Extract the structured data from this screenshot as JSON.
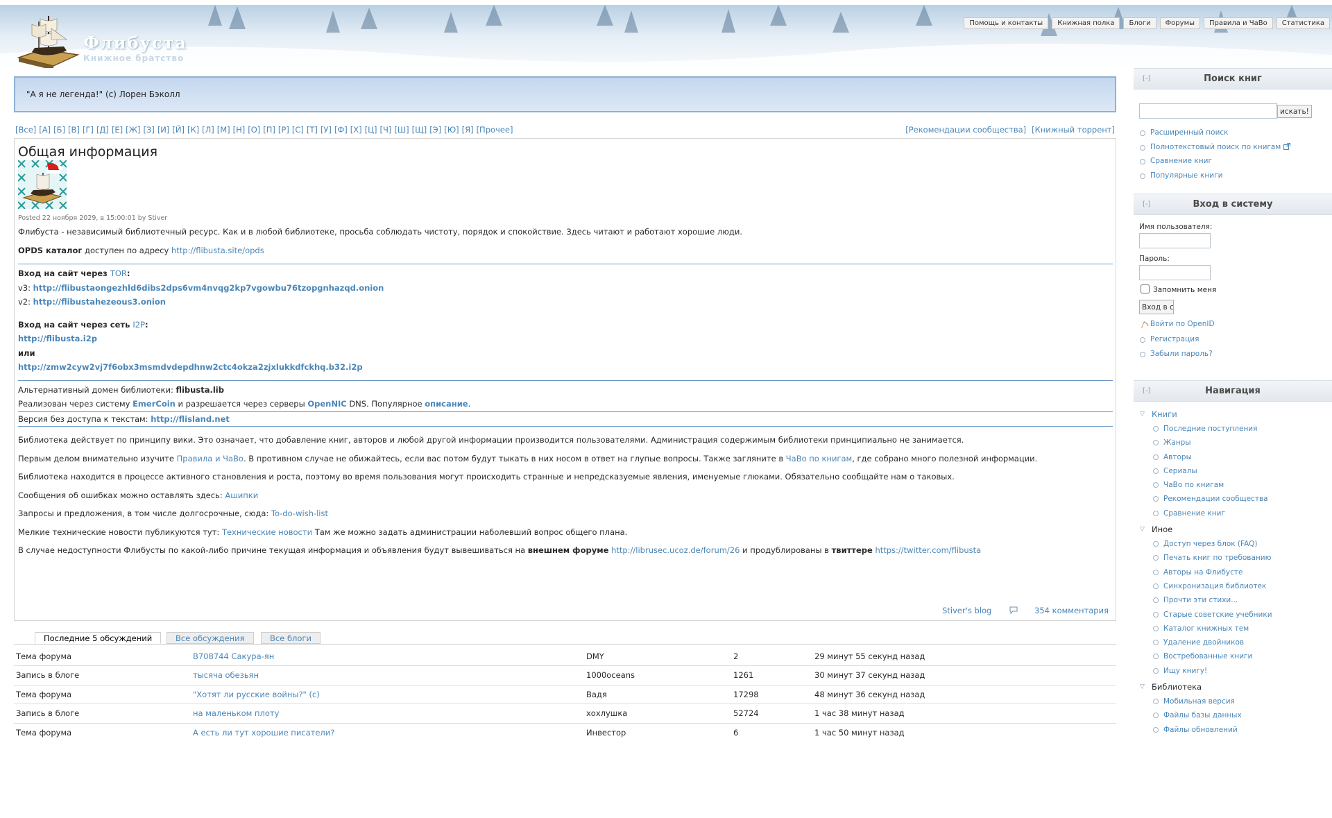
{
  "header": {
    "site_name": "Флибуста",
    "site_slogan": "Книжное братство",
    "top_links": [
      "Помощь и контакты",
      "Книжная полка",
      "Блоги",
      "Форумы",
      "Правила и ЧаВо",
      "Статистика"
    ]
  },
  "quote": "\"А я не легенда!\" (с) Лорен Бэколл",
  "alphabet": [
    "[Все]",
    "[А]",
    "[Б]",
    "[В]",
    "[Г]",
    "[Д]",
    "[Е]",
    "[Ж]",
    "[З]",
    "[И]",
    "[Й]",
    "[К]",
    "[Л]",
    "[М]",
    "[Н]",
    "[О]",
    "[П]",
    "[Р]",
    "[С]",
    "[Т]",
    "[У]",
    "[Ф]",
    "[Х]",
    "[Ц]",
    "[Ч]",
    "[Ш]",
    "[Щ]",
    "[Э]",
    "[Ю]",
    "[Я]",
    "[Прочее]"
  ],
  "top_right_links": [
    "[Рекомендации сообщества]",
    "[Книжный торрент]"
  ],
  "node": {
    "title": "Общая информация",
    "posted": "Posted 22 ноября 2029, в 15:00:01 by Stiver",
    "intro": "Флибуста - независимый библиотечный ресурс. Как и в любой библиотеке, просьба соблюдать чистоту, порядок и спокойствие. Здесь читают и работают хорошие люди.",
    "opds_label": "OPDS каталог",
    "opds_text": " доступен по адресу ",
    "opds_link": "http://flibusta.site/opds",
    "tor_label": "Вход на сайт через ",
    "tor_link": "TOR",
    "tor_colon": ":",
    "v3_label": "v3: ",
    "v3_link": "http://flibustaongezhld6dibs2dps6vm4nvqg2kp7vgowbu76tzopgnhazqd.onion",
    "v2_label": "v2: ",
    "v2_link": "http://flibustahezeous3.onion",
    "i2p_label": "Вход на сайт через сеть ",
    "i2p_link": "I2P",
    "i2p_colon": ":",
    "i2p_url1": "http://flibusta.i2p",
    "or": "или",
    "i2p_url2": "http://zmw2cyw2vj7f6obx3msmdvdepdhnw2ctc4okza2zjxlukkdfckhq.b32.i2p",
    "alt_label": "Альтернативный домен библиотеки: ",
    "alt_domain": "flibusta.lib",
    "emer_text1": "Реализован через систему ",
    "emer_link": "EmerCoin",
    "emer_text2": " и разрешается через серверы ",
    "opennic_link": "OpenNIC",
    "emer_text3": " DNS. Популярное ",
    "desc_link": "описание",
    "emer_text4": ".",
    "nolib_label": "Версия без доступа к текстам: ",
    "nolib_link": "http://flisland.net",
    "wiki": "Библиотека действует по принципу вики. Это означает, что добавление книг, авторов и любой другой информации производится пользователями. Администрация содержимым библиотеки принципиально не занимается.",
    "rules_text1": "Первым делом внимательно изучите ",
    "rules_link": "Правила и ЧаВо",
    "rules_text2": ". В противном случае не обижайтесь, если вас потом будут тыкать в них носом в ответ на глупые вопросы. Также загляните в ",
    "faq_link": "ЧаВо по книгам",
    "rules_text3": ", где собрано много полезной информации.",
    "growth": "Библиотека находится в процессе активного становления и роста, поэтому во время пользования могут происходить странные и непредсказуемые явления, именуемые глюками. Обязательно сообщайте нам о таковых.",
    "bugs_text": "Сообщения об ошибках можно оставлять здесь: ",
    "bugs_link": "Ашипки",
    "wish_text": "Запросы и предложения, в том числе долгосрочные, сюда: ",
    "wish_link": "To-do-wish-list",
    "tech_text1": "Мелкие технические новости публикуются тут: ",
    "tech_link": "Технические новости",
    "tech_text2": " Там же можно задать администрации наболевший вопрос общего плана.",
    "outage_text1": "В случае недоступности Флибусты по какой-либо причине текущая информация и объявления будут вывешиваться на ",
    "outage_b1": "внешнем форуме",
    "outage_space": " ",
    "outage_link1": "http://librusec.ucoz.de/forum/26",
    "outage_text2": " и продублированы в ",
    "outage_b2": "твиттере",
    "outage_link2": "https://twitter.com/flibusta",
    "footer_blog": "Stiver's blog",
    "footer_comments": "354 комментария"
  },
  "tabs": [
    "Последние 5 обсуждений",
    "Все обсуждения",
    "Все блоги"
  ],
  "discussions": [
    {
      "type": "Тема форума",
      "title": "B708744 Сакура-ян",
      "user": "DMY",
      "count": "2",
      "time": "29 минут 55 секунд назад"
    },
    {
      "type": "Запись в блоге",
      "title": "тысяча обезьян",
      "user": "1000oceans",
      "count": "1261",
      "time": "30 минут 37 секунд назад"
    },
    {
      "type": "Тема форума",
      "title": "\"Хотят ли русские войны?\" (с)",
      "user": "Вадя",
      "count": "17298",
      "time": "48 минут 36 секунд назад"
    },
    {
      "type": "Запись в блоге",
      "title": "на маленьком плоту",
      "user": "хохлушка",
      "count": "52724",
      "time": "1 час 38 минут назад"
    },
    {
      "type": "Тема форума",
      "title": "А есть ли тут хорошие писатели?",
      "user": "Инвестор",
      "count": "6",
      "time": "1 час 50 минут назад"
    }
  ],
  "sidebar": {
    "collapse": "[-]",
    "search": {
      "title": "Поиск книг",
      "button": "искать!",
      "links": [
        "Расширенный поиск",
        "Полнотекстовый поиск по книгам",
        "Сравнение книг",
        "Популярные книги"
      ]
    },
    "login": {
      "title": "Вход в систему",
      "user_label": "Имя пользователя:",
      "pass_label": "Пароль:",
      "remember": "Запомнить меня",
      "button": "Вход в с",
      "openid": "Войти по OpenID",
      "links": [
        "Регистрация",
        "Забыли пароль?"
      ]
    },
    "nav": {
      "title": "Навигация",
      "sections": [
        {
          "name": "Книги",
          "items": [
            "Последние поступления",
            "Жанры",
            "Авторы",
            "Сериалы",
            "ЧаВо по книгам",
            "Рекомендации сообщества",
            "Сравнение книг"
          ]
        },
        {
          "name": "Иное",
          "items": [
            "Доступ через блок (FAQ)",
            "Печать книг по требованию",
            "Авторы на Флибусте",
            "Синхронизация библиотек",
            "Прочти эти стихи...",
            "Старые советские учебники",
            "Каталог книжных тем",
            "Удаление двойников",
            "Востребованные книги",
            "Ищу книгу!"
          ]
        },
        {
          "name": "Библиотека",
          "items": [
            "Мобильная версия",
            "Файлы базы данных",
            "Файлы обновлений"
          ]
        }
      ]
    }
  }
}
